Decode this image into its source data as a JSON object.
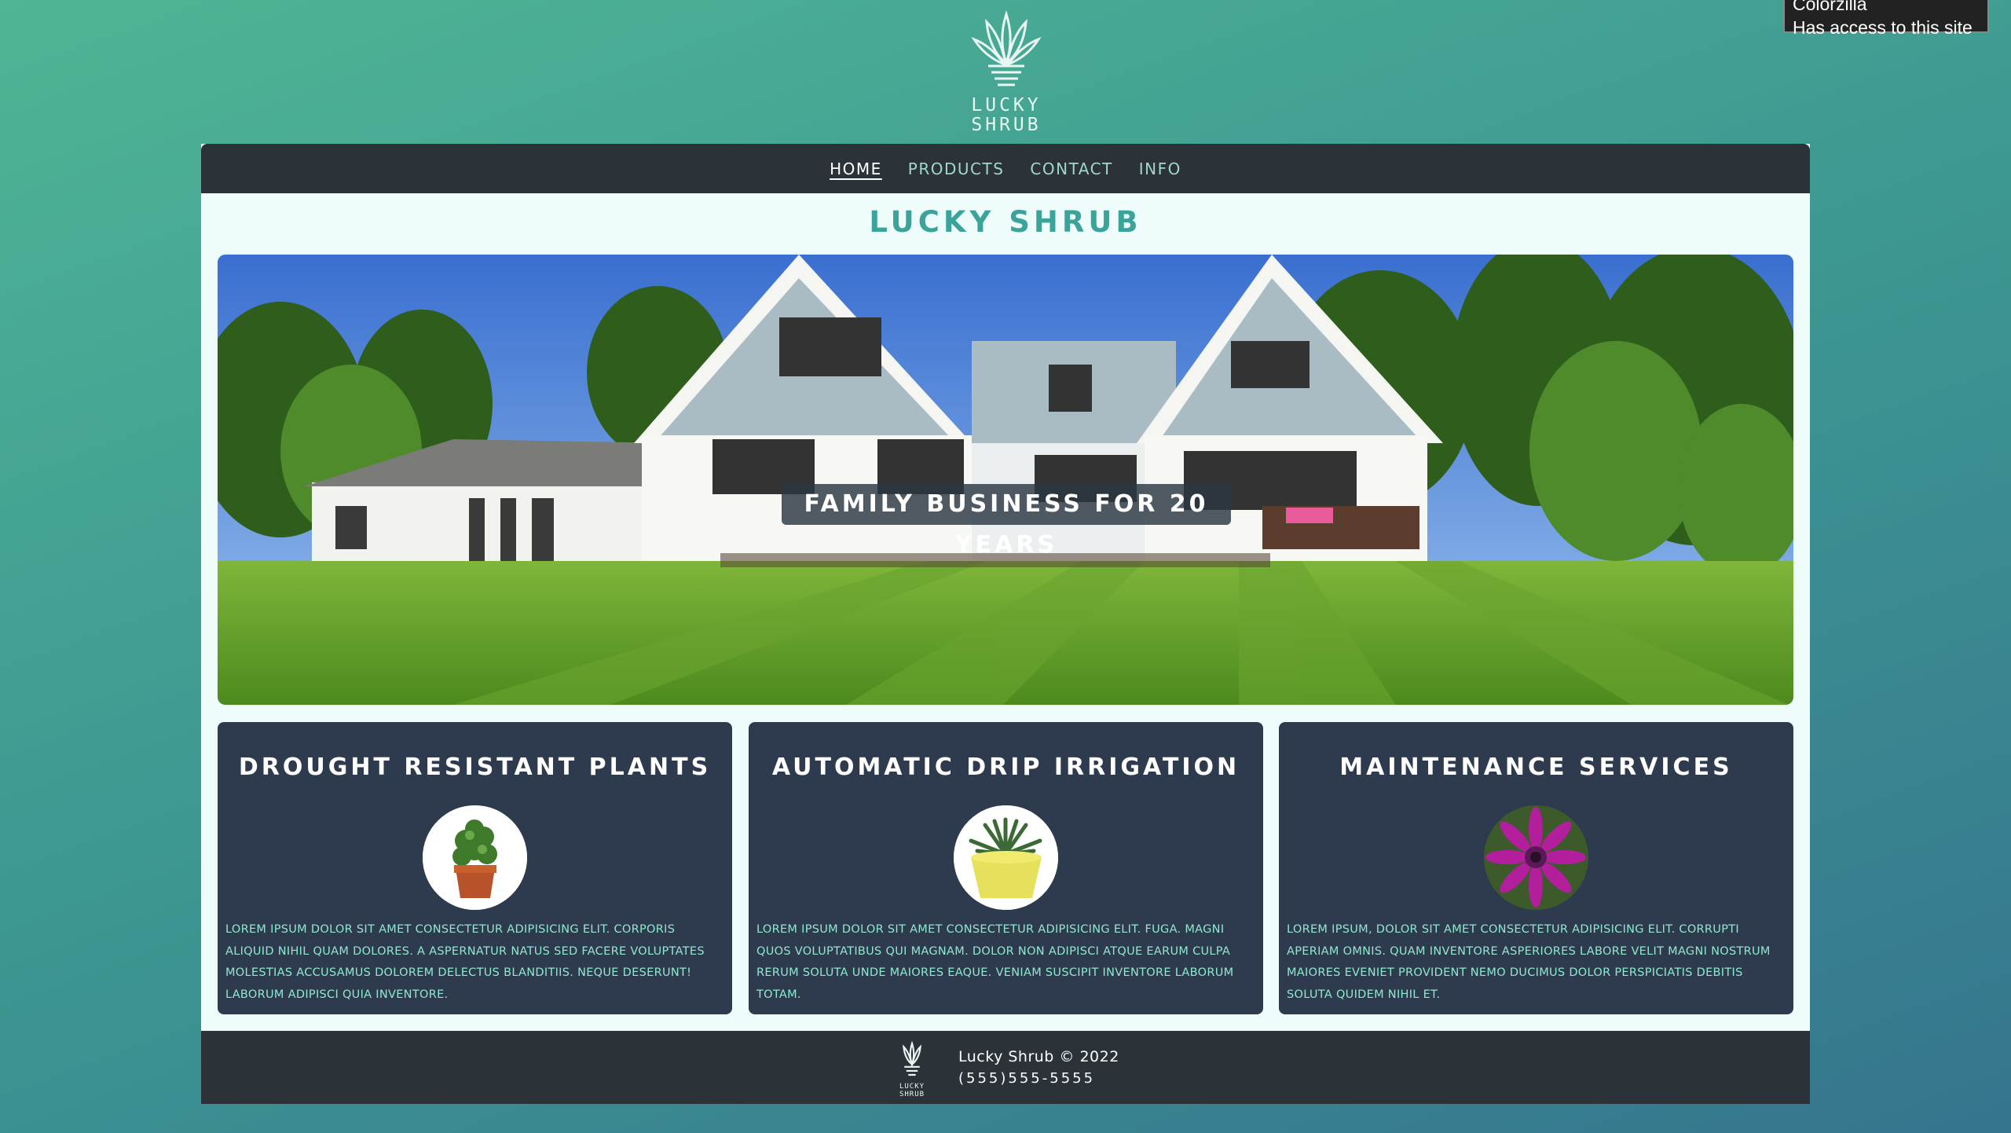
{
  "tooltip": {
    "line1": "Colorzilla",
    "line2": "Has access to this site"
  },
  "brand": {
    "logo_line1": "LUCKY",
    "logo_line2": "SHRUB"
  },
  "nav": {
    "items": [
      {
        "label": "Home",
        "active": true
      },
      {
        "label": "Products",
        "active": false
      },
      {
        "label": "Contact",
        "active": false
      },
      {
        "label": "Info",
        "active": false
      }
    ]
  },
  "main": {
    "title": "LUCKY SHRUB",
    "hero_caption": "Family business for 20 years"
  },
  "cards": [
    {
      "title": "Drought resistant plants",
      "image": "potted-shrub",
      "text": "Lorem ipsum dolor sit amet consectetur adipisicing elit. Corporis aliquid nihil quam dolores. A aspernatur natus sed facere voluptates molestias accusamus dolorem delectus blanditiis. Neque deserunt! Laborum adipisci quia inventore."
    },
    {
      "title": "Automatic drip irrigation",
      "image": "succulent-yellow-pot",
      "text": "Lorem ipsum dolor sit amet consectetur adipisicing elit. Fuga. Magni quos voluptatibus qui magnam. Dolor non adipisci atque earum culpa rerum soluta unde maiores eaque. Veniam suscipit inventore laborum totam."
    },
    {
      "title": "Maintenance services",
      "image": "purple-daisy",
      "text": "Lorem ipsum, dolor sit amet consectetur adipisicing elit. Corrupti aperiam omnis. Quam inventore asperiores labore velit magni nostrum maiores eveniet provident nemo ducimus dolor perspiciatis debitis soluta quidem nihil et."
    }
  ],
  "footer": {
    "copyright": "Lucky Shrub © 2022",
    "phone": "(555)555-5555",
    "logo_line1": "LUCKY",
    "logo_line2": "SHRUB"
  },
  "colors": {
    "accent": "#3aa39a",
    "nav_bg": "#2b3238",
    "card_bg": "#2e3a4d",
    "card_text": "#8fe8cf"
  }
}
